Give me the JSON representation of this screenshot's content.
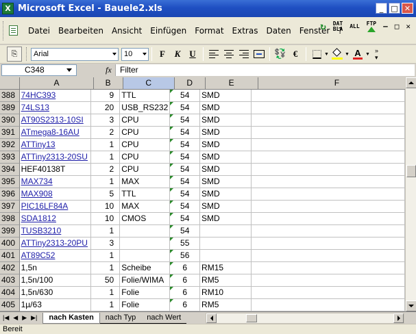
{
  "window": {
    "title": "Microsoft Excel - Bauele2.xls",
    "app_icon_letter": "X",
    "minimize": "_",
    "maximize": "□",
    "close": "✕"
  },
  "menu": {
    "items": [
      "Datei",
      "Bearbeiten",
      "Ansicht",
      "Einfügen",
      "Format",
      "Extras",
      "Daten",
      "Fenster",
      "?"
    ],
    "extra_tools": {
      "datbla_top": "DAT",
      "datbla_bottom": "BLA",
      "all": "ALL",
      "ftp": "FTP"
    },
    "doc_controls": [
      "–",
      "□",
      "✕"
    ]
  },
  "toolbar": {
    "font_name": "Arial",
    "font_size": "10",
    "bold": "F",
    "italic": "K",
    "underline": "U",
    "currency": "€",
    "font_color_letter": "A"
  },
  "formula_bar": {
    "cell_ref": "C348",
    "fx": "fx",
    "content": "Filter"
  },
  "columns": [
    {
      "label": "A",
      "active": false
    },
    {
      "label": "B",
      "active": false
    },
    {
      "label": "C",
      "active": true
    },
    {
      "label": "D",
      "active": false
    },
    {
      "label": "E",
      "active": false
    },
    {
      "label": "F",
      "active": false
    }
  ],
  "rows": [
    {
      "num": "388",
      "a": "74HC393",
      "a_link": true,
      "b": "9",
      "c": "TTL",
      "d": "54",
      "e": "SMD"
    },
    {
      "num": "389",
      "a": "74LS13",
      "a_link": true,
      "b": "20",
      "c": "USB_RS232",
      "d": "54",
      "e": "SMD"
    },
    {
      "num": "390",
      "a": "AT90S2313-10SI",
      "a_link": true,
      "b": "3",
      "c": "CPU",
      "d": "54",
      "e": "SMD"
    },
    {
      "num": "391",
      "a": "ATmega8-16AU",
      "a_link": true,
      "b": "2",
      "c": "CPU",
      "d": "54",
      "e": "SMD"
    },
    {
      "num": "392",
      "a": "ATTiny13",
      "a_link": true,
      "b": "1",
      "c": "CPU",
      "d": "54",
      "e": "SMD"
    },
    {
      "num": "393",
      "a": "ATTiny2313-20SU",
      "a_link": true,
      "b": "1",
      "c": "CPU",
      "d": "54",
      "e": "SMD"
    },
    {
      "num": "394",
      "a": "HEF40138T",
      "a_link": false,
      "b": "2",
      "c": "CPU",
      "d": "54",
      "e": "SMD"
    },
    {
      "num": "395",
      "a": "MAX734",
      "a_link": true,
      "b": "1",
      "c": "MAX",
      "d": "54",
      "e": "SMD"
    },
    {
      "num": "396",
      "a": "MAX908",
      "a_link": true,
      "b": "5",
      "c": "TTL",
      "d": "54",
      "e": "SMD"
    },
    {
      "num": "397",
      "a": "PIC16LF84A",
      "a_link": true,
      "b": "10",
      "c": "MAX",
      "d": "54",
      "e": "SMD"
    },
    {
      "num": "398",
      "a": "SDA1812",
      "a_link": true,
      "b": "10",
      "c": "CMOS",
      "d": "54",
      "e": "SMD"
    },
    {
      "num": "399",
      "a": "TUSB3210",
      "a_link": true,
      "b": "1",
      "c": "",
      "d": "54",
      "e": ""
    },
    {
      "num": "400",
      "a": "ATTiny2313-20PU",
      "a_link": true,
      "b": "3",
      "c": "",
      "d": "55",
      "e": ""
    },
    {
      "num": "401",
      "a": "AT89C52",
      "a_link": true,
      "b": "1",
      "c": "",
      "d": "56",
      "e": ""
    },
    {
      "num": "402",
      "a": "1,5n",
      "a_link": false,
      "b": "1",
      "c": "Scheibe",
      "d": "6",
      "e": "RM15"
    },
    {
      "num": "403",
      "a": "1,5n/100",
      "a_link": false,
      "b": "50",
      "c": "Folie/WIMA",
      "d": "6",
      "e": "RM5"
    },
    {
      "num": "404",
      "a": "1,5n/630",
      "a_link": false,
      "b": "1",
      "c": "Folie",
      "d": "6",
      "e": "RM10"
    },
    {
      "num": "405",
      "a": "1µ/63",
      "a_link": false,
      "b": "1",
      "c": "Folie",
      "d": "6",
      "e": "RM5"
    }
  ],
  "sheet_tabs": [
    {
      "label": "nach Kasten",
      "active": true
    },
    {
      "label": "nach Typ",
      "active": false
    },
    {
      "label": "nach Wert",
      "active": false
    }
  ],
  "status": "Bereit",
  "colors": {
    "title_bar": "#1f4fc2",
    "link": "#1d1da8",
    "comment_marker": "#2a8a2a"
  }
}
